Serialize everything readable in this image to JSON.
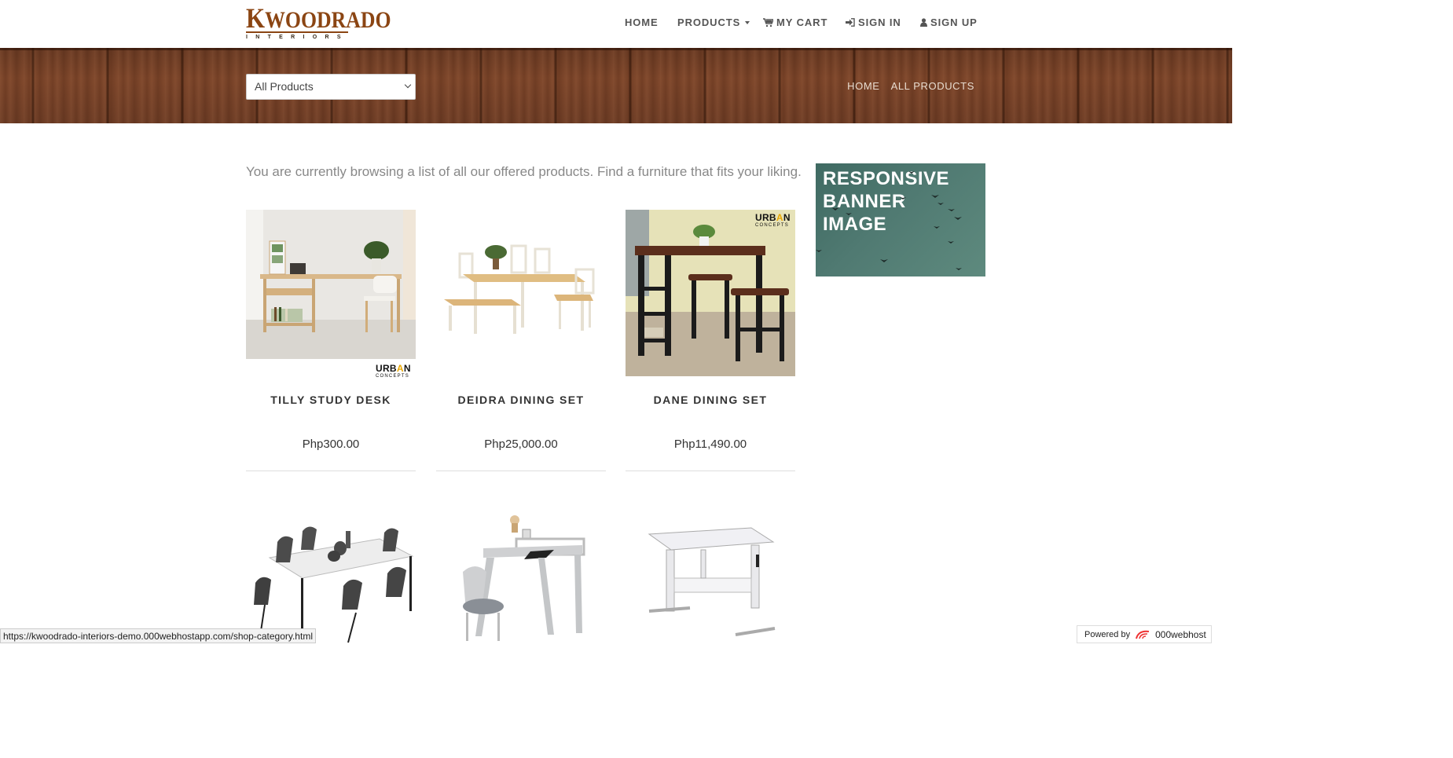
{
  "header": {
    "logo_main_cap": "K",
    "logo_main_rest": "WOODRADO",
    "logo_sub": "INTERIORS",
    "nav": {
      "home": "HOME",
      "products": "PRODUCTS",
      "cart": "MY CART",
      "signin": "SIGN IN",
      "signup": "SIGN UP"
    }
  },
  "banner": {
    "category_select": "All Products",
    "breadcrumb": [
      "HOME",
      "ALL PRODUCTS"
    ]
  },
  "intro": "You are currently browsing a list of all our offered products. Find a furniture that fits your liking.",
  "ad": {
    "line1": "RESPONSIVE",
    "line2": "BANNER",
    "line3": "IMAGE"
  },
  "products": [
    {
      "name": "TILLY STUDY DESK",
      "price": "Php300.00"
    },
    {
      "name": "DEIDRA DINING SET",
      "price": "Php25,000.00"
    },
    {
      "name": "DANE DINING SET",
      "price": "Php11,490.00"
    }
  ],
  "watermark": {
    "brand_top": "URB",
    "brand_o": "A",
    "brand_end": "N",
    "brand_sub": "CONCEPTS"
  },
  "status_url": "https://kwoodrado-interiors-demo.000webhostapp.com/shop-category.html",
  "powered": {
    "label": "Powered by",
    "brand": "000webhost"
  },
  "colors": {
    "accent": "#8b4513",
    "wood": "#7d4428",
    "ad_bg": "#507a72"
  }
}
